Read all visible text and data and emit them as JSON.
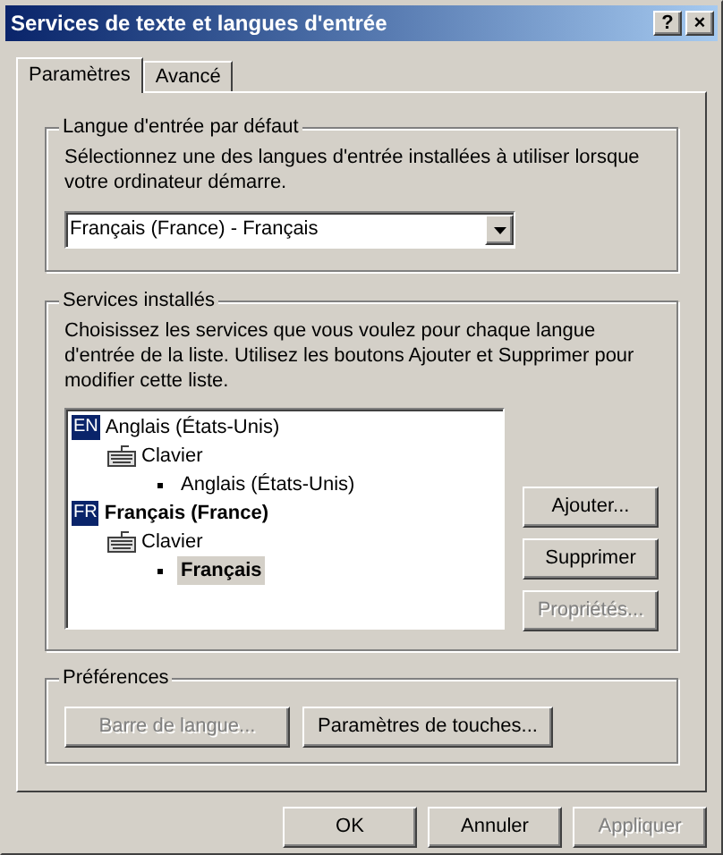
{
  "window": {
    "title": "Services de texte et langues d'entrée",
    "title_buttons": [
      "?",
      "×"
    ]
  },
  "tabs": [
    {
      "label": "Paramètres",
      "selected": true
    },
    {
      "label": "Avancé",
      "selected": false
    }
  ],
  "default_language": {
    "title": "Langue d'entrée par défaut",
    "description": "Sélectionnez une des langues d'entrée installées à utiliser lorsque votre ordinateur démarre.",
    "dropdown": {
      "value": "Français (France) - Français"
    }
  },
  "installed_services": {
    "title": "Services installés",
    "description": "Choisissez les services que vous voulez pour chaque langue d'entrée de la liste. Utilisez les boutons Ajouter et Supprimer pour modifier cette liste.",
    "tree": [
      {
        "kind": "language",
        "code": "EN",
        "label": "Anglais (États-Unis)",
        "bold": false,
        "children": [
          {
            "kind": "category",
            "label": "Clavier",
            "children": [
              {
                "kind": "service",
                "label": "Anglais (États-Unis)",
                "selected": false,
                "bold": false
              }
            ]
          }
        ]
      },
      {
        "kind": "language",
        "code": "FR",
        "label": "Français (France)",
        "bold": true,
        "children": [
          {
            "kind": "category",
            "label": "Clavier",
            "children": [
              {
                "kind": "service",
                "label": "Français",
                "selected": true,
                "bold": true
              }
            ]
          }
        ]
      }
    ],
    "buttons": [
      {
        "label": "Ajouter...",
        "disabled": false
      },
      {
        "label": "Supprimer",
        "disabled": false
      },
      {
        "label": "Propriétés...",
        "disabled": true
      }
    ]
  },
  "preferences": {
    "title": "Préférences",
    "buttons": [
      {
        "label": "Barre de langue...",
        "disabled": true
      },
      {
        "label": "Paramètres de touches...",
        "disabled": false
      }
    ]
  },
  "dialog_buttons": [
    {
      "label": "OK",
      "disabled": false
    },
    {
      "label": "Annuler",
      "disabled": false
    },
    {
      "label": "Appliquer",
      "disabled": true
    }
  ]
}
